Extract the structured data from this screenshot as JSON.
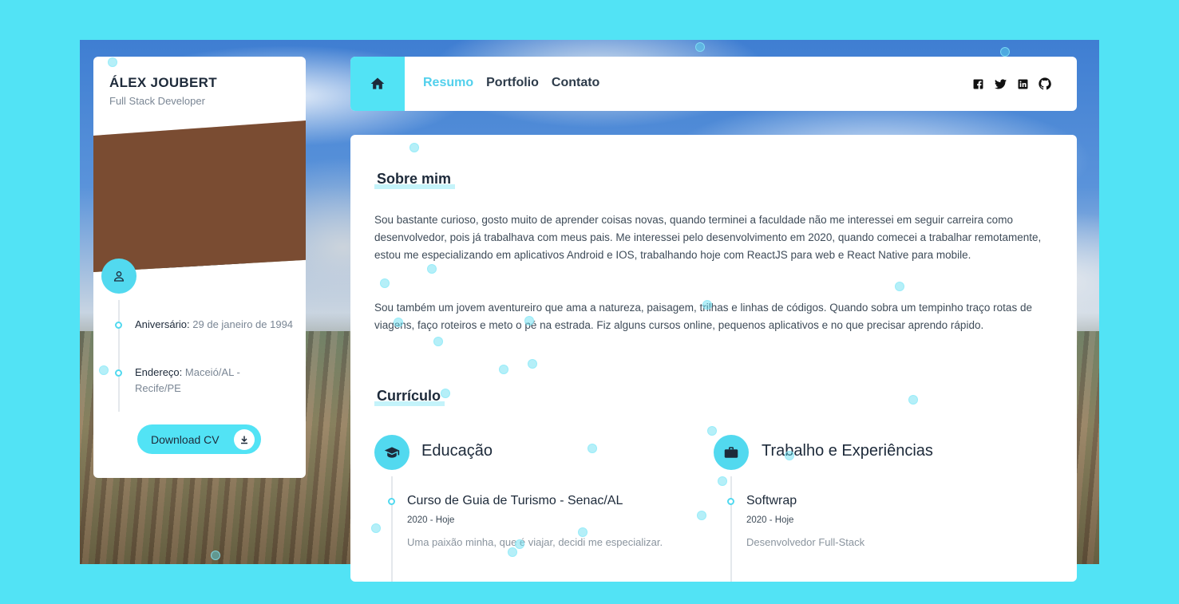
{
  "profile": {
    "name": "ÁLEX JOUBERT",
    "role": "Full Stack Developer",
    "birthday_label": "Aniversário:",
    "birthday_value": "29 de janeiro de 1994",
    "address_label": "Endereço:",
    "address_value": "Maceió/AL - Recife/PE",
    "download_label": "Download CV"
  },
  "nav": {
    "links": [
      "Resumo",
      "Portfolio",
      "Contato"
    ],
    "active": "Resumo",
    "socials": [
      "facebook-icon",
      "twitter-icon",
      "linkedin-icon",
      "github-icon"
    ]
  },
  "about": {
    "title": "Sobre mim",
    "p1": "Sou bastante curioso, gosto muito de aprender coisas novas, quando terminei a faculdade não me interessei em seguir carreira como desenvolvedor, pois já trabalhava com meus pais. Me interessei pelo desenvolvimento em 2020, quando comecei a trabalhar remotamente, estou me especializando em aplicativos Android e IOS, trabalhando hoje com ReactJS para web e React Native para mobile.",
    "p2": "Sou também um jovem aventureiro que ama a natureza, paisagem, trilhas e linhas de códigos. Quando sobra um tempinho traço rotas de viagens, faço roteiros e meto o pé na estrada. Fiz alguns cursos online, pequenos aplicativos e no que precisar aprendo rápido."
  },
  "resume": {
    "title": "Currículo",
    "education": {
      "title": "Educação",
      "items": [
        {
          "title": "Curso de Guia de Turismo - Senac/AL",
          "date": "2020 - Hoje",
          "desc": "Uma paixão minha, que é viajar, decidi me especializar."
        }
      ]
    },
    "work": {
      "title": "Trabalho e Experiências",
      "items": [
        {
          "title": "Softwrap",
          "date": "2020 - Hoje",
          "desc": "Desenvolvedor Full-Stack"
        }
      ]
    }
  },
  "colors": {
    "accent": "#52e3f5",
    "text": "#1d2a3a",
    "muted": "#7a8694"
  }
}
